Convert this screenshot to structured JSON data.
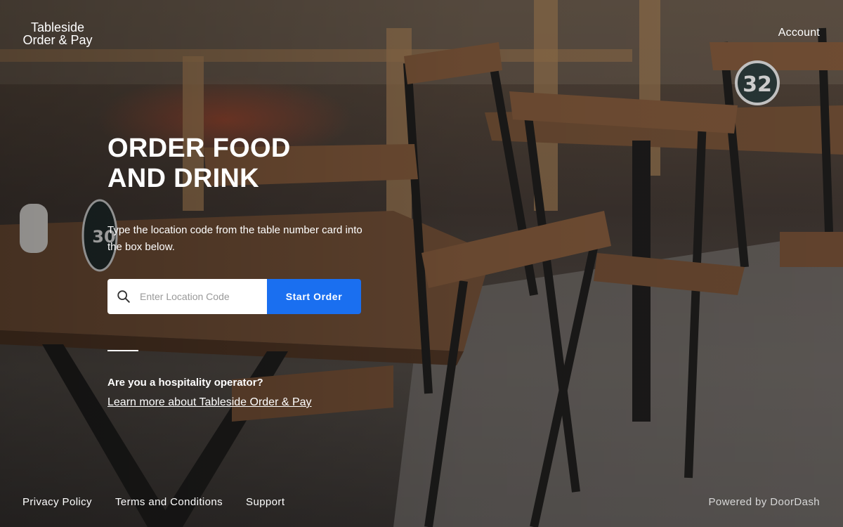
{
  "header": {
    "logo_line1": "Tableside",
    "logo_line2": "Order & Pay",
    "account_label": "Account"
  },
  "hero": {
    "title_line1": "ORDER FOOD",
    "title_line2": "AND DRINK",
    "subtitle": "Type the location code from the table number card into the box below."
  },
  "search": {
    "placeholder": "Enter Location Code",
    "value": "",
    "button_label": "Start Order"
  },
  "operator": {
    "question": "Are you a hospitality operator?",
    "link_label": "Learn more about Tableside Order & Pay"
  },
  "footer": {
    "links": [
      "Privacy Policy",
      "Terms and Conditions",
      "Support"
    ],
    "powered_by": "Powered by DoorDash"
  },
  "background": {
    "table_numbers": [
      "32",
      "30"
    ]
  },
  "colors": {
    "accent": "#1a6ff0",
    "text": "#ffffff"
  },
  "icons": {
    "search": "search-icon"
  }
}
